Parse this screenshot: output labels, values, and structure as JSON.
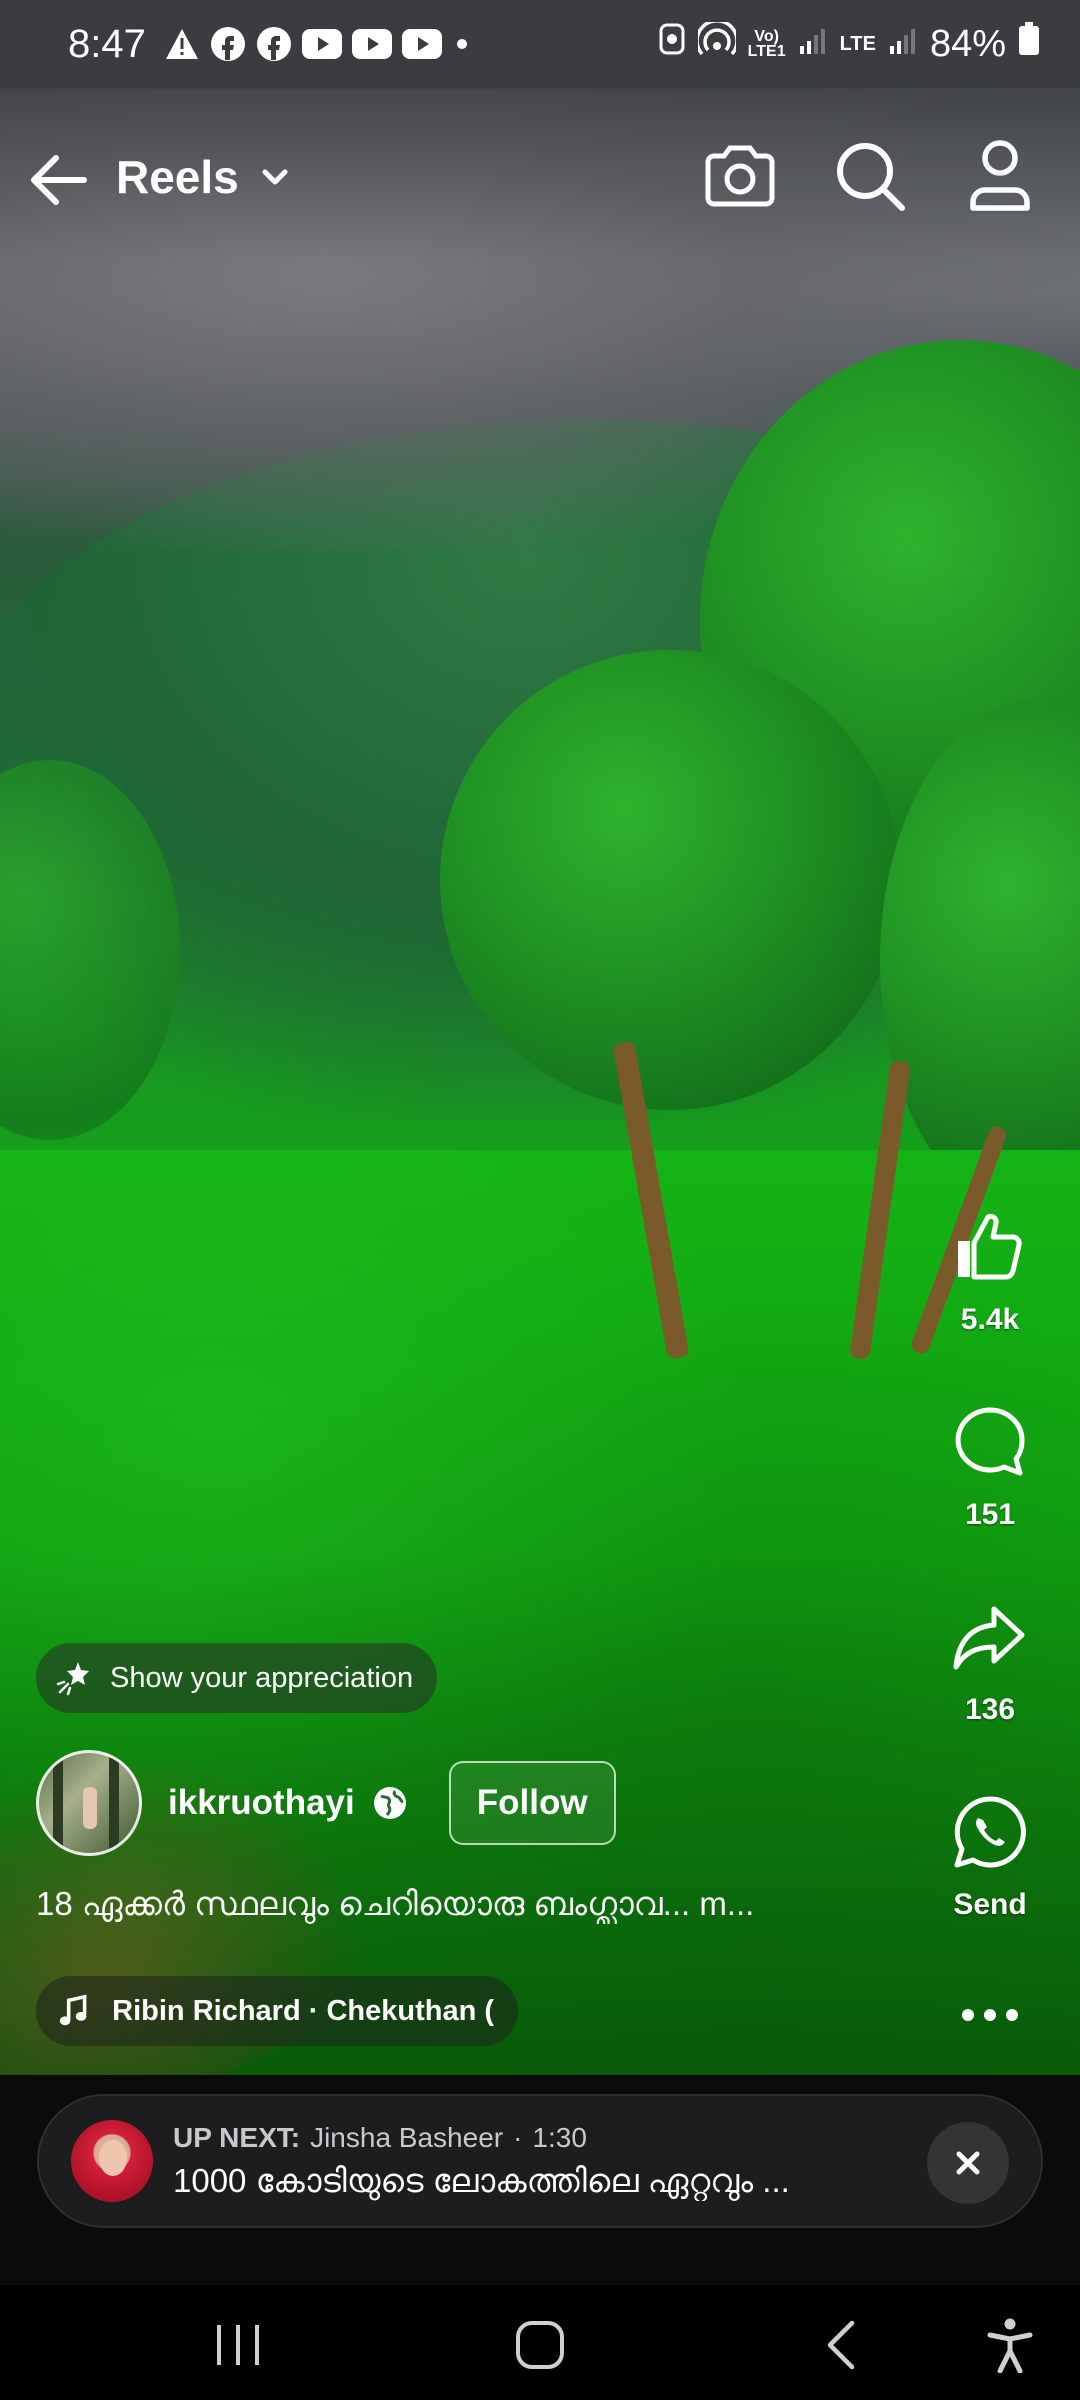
{
  "status_bar": {
    "time": "8:47",
    "battery": "84%",
    "network_1": "Vo) LTE1",
    "network_2": "LTE"
  },
  "header": {
    "title": "Reels",
    "icons": [
      "back-arrow-icon",
      "chevron-down-icon",
      "camera-icon",
      "search-icon",
      "profile-icon"
    ]
  },
  "actions": {
    "like_count": "5.4k",
    "comment_count": "151",
    "share_count": "136",
    "send_label": "Send"
  },
  "post": {
    "appreciation_label": "Show your appreciation",
    "author": "ikkruothayi",
    "follow_label": "Follow",
    "caption": "18 ഏക്കർ സ്ഥലവും ചെറിയൊരു ബംഗ്ലാവ... m...",
    "music": "Ribin Richard · Chekuthan ("
  },
  "up_next": {
    "label": "UP NEXT:",
    "author": "Jinsha Basheer",
    "separator": "·",
    "duration": "1:30",
    "title": "1000 കോടിയുടെ ലോകത്തിലെ ഏറ്റവും ..."
  },
  "colors": {
    "accent": "#ffffff",
    "grass": "#12a513",
    "surface": "#1d1d1f"
  }
}
